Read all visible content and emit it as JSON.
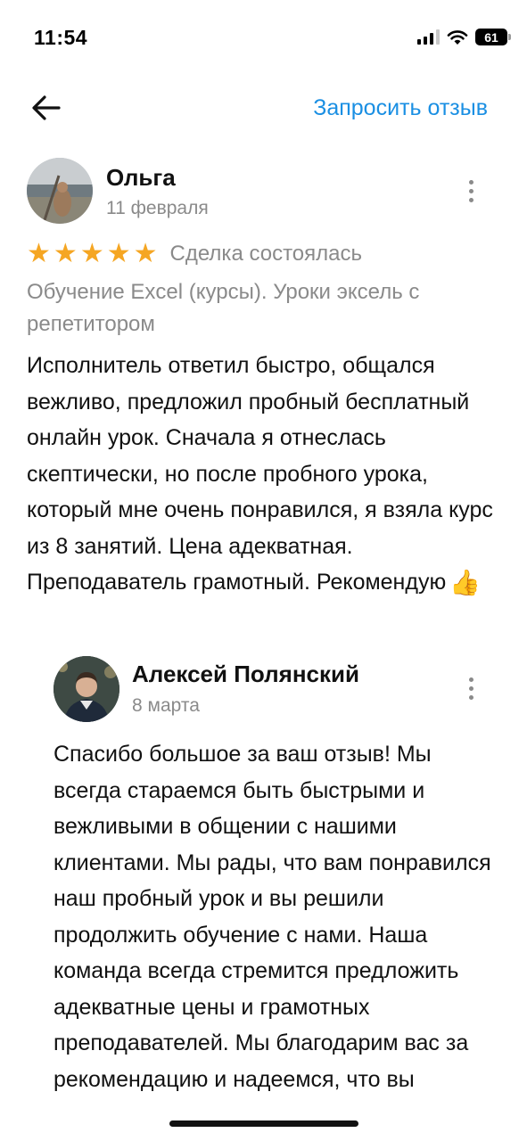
{
  "status_bar": {
    "time": "11:54",
    "battery": "61"
  },
  "header": {
    "back_icon": "arrow-left-icon",
    "request_review_label": "Запросить отзыв",
    "accent_color": "#1a8fe3"
  },
  "review": {
    "author_name": "Ольга",
    "date": "11 февраля",
    "rating": 5,
    "rating_max": 5,
    "deal_status": "Сделка состоялась",
    "service": "Обучение Excel (курсы). Уроки эксель с репетитором",
    "text": "Исполнитель ответил быстро, общался вежливо, предложил пробный бесплатный онлайн урок. Сначала я отнеслась скептически, но после пробного урока, который мне очень понравился, я взяла курс из 8 занятий. Цена адекватная. Преподаватель грамотный. Рекомендую",
    "emoji": "👍",
    "star_color": "#f5a623"
  },
  "reply": {
    "author_name": "Алексей Полянский",
    "date": "8 марта",
    "text": "Спасибо большое за ваш отзыв! Мы всегда стараемся быть быстрыми и вежливыми в общении с нашими клиентами. Мы рады, что вам понравился наш пробный урок и вы решили продолжить обучение с нами. Наша команда всегда стремится предложить адекватные цены и грамотных преподавателей. Мы благодарим вас за рекомендацию и надеемся, что вы"
  }
}
